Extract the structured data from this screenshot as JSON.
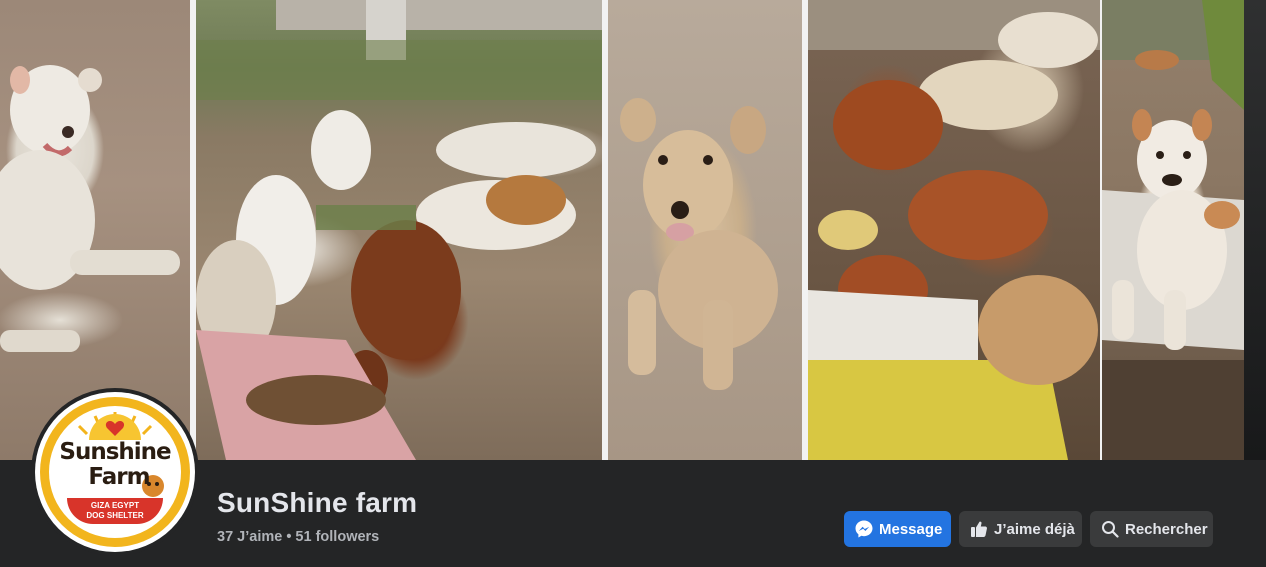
{
  "cover": {
    "panels": [
      {
        "name": "white-dog-lying"
      },
      {
        "name": "dogs-eating-group"
      },
      {
        "name": "tan-puppy-sitting"
      },
      {
        "name": "dogs-eating-corn"
      },
      {
        "name": "white-brown-dog-on-slab"
      }
    ]
  },
  "avatar": {
    "logo_line1": "Sunshine",
    "logo_line2": "Farm",
    "banner_line1": "GIZA EGYPT",
    "banner_line2": "DOG SHELTER"
  },
  "profile": {
    "name": "SunShine farm",
    "stats": "37 J’aime • 51 followers"
  },
  "actions": {
    "message_label": "Message",
    "like_label": "J’aime déjà",
    "search_label": "Rechercher"
  },
  "colors": {
    "background": "#242526",
    "primary_button": "#2374e1",
    "secondary_button": "#3a3b3c",
    "logo_yellow": "#f2b51d",
    "logo_red": "#d8342a"
  },
  "icons": {
    "message": "messenger-icon",
    "like": "thumbs-up-icon",
    "search": "search-icon"
  }
}
